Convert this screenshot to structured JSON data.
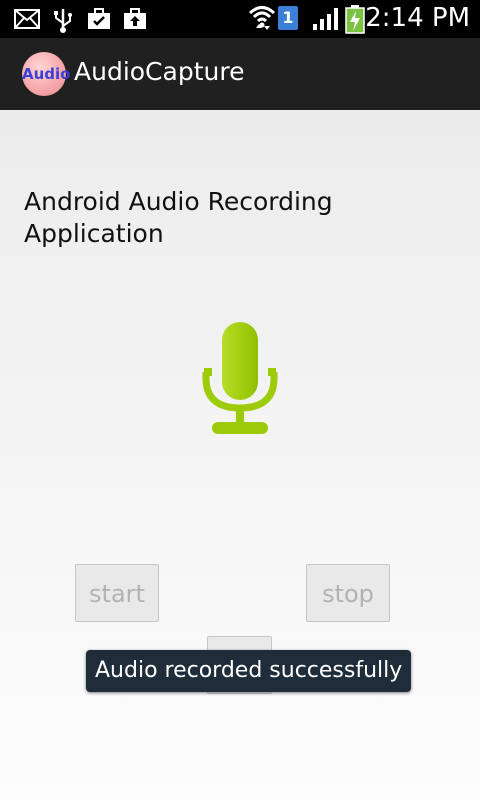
{
  "status_bar": {
    "time": "2:14 PM",
    "sim_badge": "1",
    "icons": [
      "mail-icon",
      "usb-icon",
      "briefcase-check-icon",
      "briefcase-upload-icon",
      "wifi-icon",
      "signal-icon",
      "battery-charging-icon"
    ]
  },
  "action_bar": {
    "app_icon_label": "Audio",
    "title": "AudioCapture"
  },
  "main": {
    "heading": "Android Audio Recording Application",
    "icon": "microphone-icon",
    "start_label": "start",
    "stop_label": "stop",
    "play_label": ""
  },
  "toast": {
    "message": "Audio recorded successfully"
  },
  "colors": {
    "mic": "#9ecb09",
    "toast_bg": "#1f2d3a",
    "action_bar": "#202020"
  }
}
